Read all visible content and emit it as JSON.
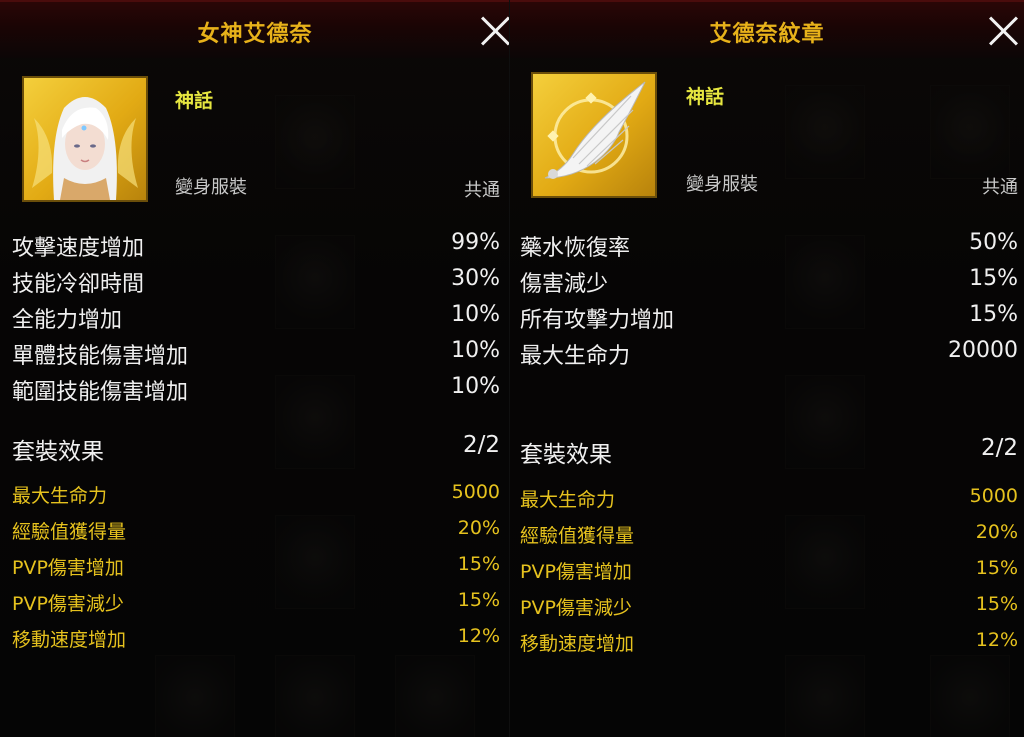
{
  "left_panel": {
    "title": "女神艾德奈",
    "rarity": "神話",
    "type": "變身服裝",
    "shared": "共通",
    "stats": [
      {
        "name": "攻擊速度增加",
        "value": "99%"
      },
      {
        "name": "技能冷卻時間",
        "value": "30%"
      },
      {
        "name": "全能力增加",
        "value": "10%"
      },
      {
        "name": "單體技能傷害增加",
        "value": "10%"
      },
      {
        "name": "範圍技能傷害增加",
        "value": "10%"
      }
    ],
    "set_effect": {
      "title": "套裝效果",
      "count": "2/2",
      "items": [
        {
          "name": "最大生命力",
          "value": "5000"
        },
        {
          "name": "經驗值獲得量",
          "value": "20%"
        },
        {
          "name": "PVP傷害增加",
          "value": "15%"
        },
        {
          "name": "PVP傷害減少",
          "value": "15%"
        },
        {
          "name": "移動速度增加",
          "value": "12%"
        }
      ]
    }
  },
  "right_panel": {
    "title": "艾德奈紋章",
    "rarity": "神話",
    "type": "變身服裝",
    "shared": "共通",
    "stats": [
      {
        "name": "藥水恢復率",
        "value": "50%"
      },
      {
        "name": "傷害減少",
        "value": "15%"
      },
      {
        "name": "所有攻擊力增加",
        "value": "15%"
      },
      {
        "name": "最大生命力",
        "value": "20000"
      }
    ],
    "set_effect": {
      "title": "套裝效果",
      "count": "2/2",
      "items": [
        {
          "name": "最大生命力",
          "value": "5000"
        },
        {
          "name": "經驗值獲得量",
          "value": "20%"
        },
        {
          "name": "PVP傷害增加",
          "value": "15%"
        },
        {
          "name": "PVP傷害減少",
          "value": "15%"
        },
        {
          "name": "移動速度增加",
          "value": "12%"
        }
      ]
    }
  },
  "colors": {
    "title_gold": "#e8b21a",
    "rarity_yellow": "#e6e640",
    "set_gold": "#e6c21e",
    "portrait_gold": "#f4cf3c",
    "header_red": "#2a0606"
  },
  "icons": {
    "left_portrait": "goddess-portrait-icon",
    "right_portrait": "wing-emblem-icon",
    "close": "close-icon"
  }
}
